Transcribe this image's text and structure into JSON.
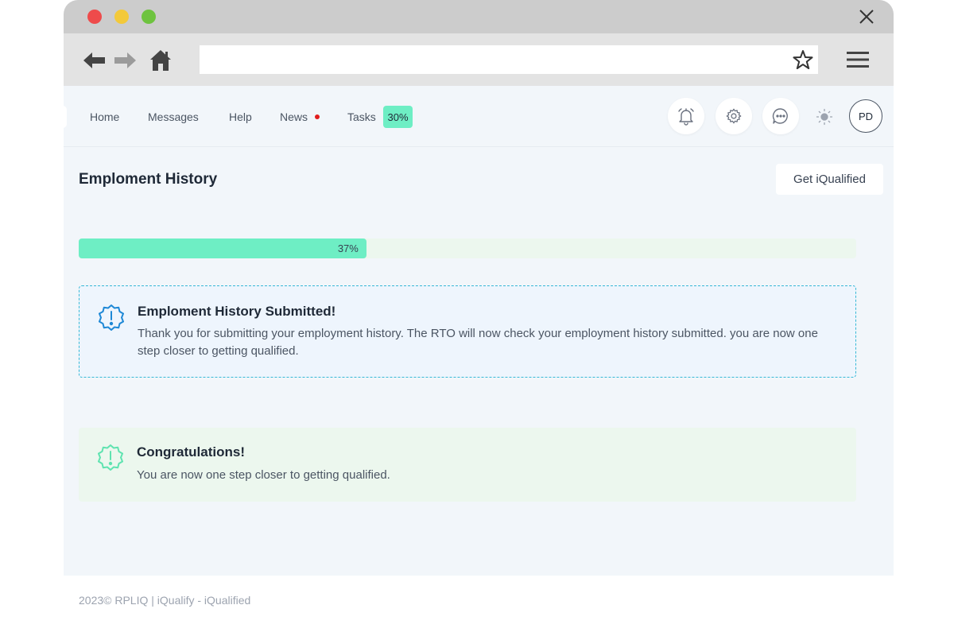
{
  "nav": {
    "home": "Home",
    "messages": "Messages",
    "help": "Help",
    "news": "News",
    "tasks": "Tasks",
    "tasks_badge": "30%"
  },
  "user": {
    "initials": "PD"
  },
  "page": {
    "title": "Emploment History",
    "action_button": "Get iQualified"
  },
  "progress": {
    "value": 0.37,
    "label": "37%"
  },
  "alerts": {
    "info": {
      "title": "Emploment History Submitted!",
      "text": "Thank you for submitting your employment history. The RTO will now check your employment history submitted. you are now one step closer to getting qualified."
    },
    "success": {
      "title": "Congratulations!",
      "text": "You are now one step closer to getting qualified."
    }
  },
  "footer": {
    "text": "2023© RPLIQ | iQualify - iQualified"
  },
  "colors": {
    "accent": "#6eeec4",
    "info_border": "#36b8d6",
    "info_icon": "#1e88d6",
    "success_icon": "#5fe3b0",
    "notification_dot": "#e11d1d"
  },
  "icons": [
    "close-icon",
    "back-arrow-icon",
    "forward-arrow-icon",
    "home-icon",
    "star-icon",
    "hamburger-menu-icon",
    "bell-icon",
    "gear-icon",
    "chat-icon",
    "sun-icon",
    "alert-badge-icon"
  ]
}
